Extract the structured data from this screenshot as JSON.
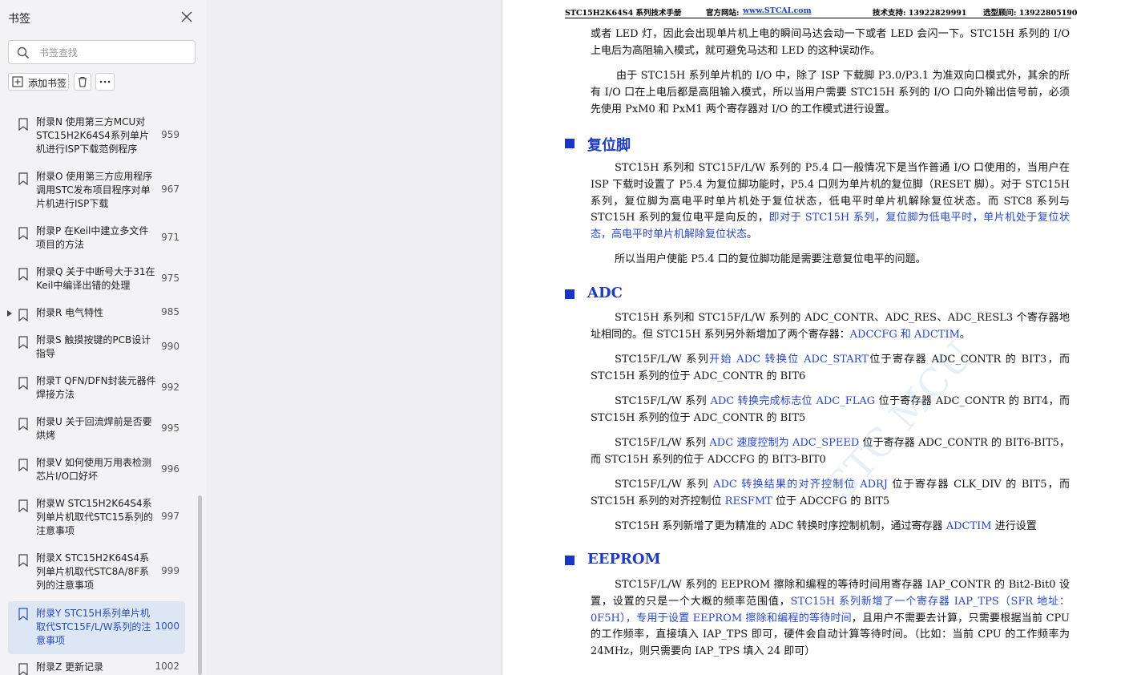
{
  "sidebar": {
    "title": "书签",
    "search_placeholder": "书签查找",
    "add_label": "添加书签",
    "items": [
      {
        "label": "附录N 使用第三方MCU对STC15H2K64S4系列单片机进行ISP下载范例程序",
        "page": "959"
      },
      {
        "label": "附录O 使用第三方应用程序调用STC发布项目程序对单片机进行ISP下载",
        "page": "967"
      },
      {
        "label": "附录P 在Keil中建立多文件项目的方法",
        "page": "971"
      },
      {
        "label": "附录Q 关于中断号大于31在Keil中编译出错的处理",
        "page": "975"
      },
      {
        "label": "附录R 电气特性",
        "page": "985"
      },
      {
        "label": "附录S 触摸按键的PCB设计指导",
        "page": "990"
      },
      {
        "label": "附录T QFN/DFN封装元器件焊接方法",
        "page": "992"
      },
      {
        "label": "附录U 关于回流焊前是否要烘烤",
        "page": "995"
      },
      {
        "label": "附录V 如何使用万用表检测芯片I/O口好坏",
        "page": "996"
      },
      {
        "label": "附录W STC15H2K64S4系列单片机取代STC15系列的注意事项",
        "page": "997"
      },
      {
        "label": "附录X STC15H2K64S4系列单片机取代STC8A/8F系列的注意事项",
        "page": "999"
      },
      {
        "label": "附录Y STC15H系列单片机取代STC15F/L/W系列的注意事项",
        "page": "1000"
      },
      {
        "label": "附录Z 更新记录",
        "page": "1002"
      }
    ]
  },
  "document": {
    "header": {
      "manual": "STC15H2K64S4 系列技术手册",
      "site_label": "官方网站:",
      "site_url": "www.STCAI.com",
      "support": "技术支持: 13922829991",
      "consult": "选型顾问: 13922805190"
    },
    "p1": "或者 LED 灯，因此会出现单片机上电的瞬间马达会动一下或者 LED 会闪一下。STC15H 系列的 I/O 上电后为高阻输入模式，就可避免马达和 LED 的这种误动作。",
    "p2": "由于 STC15H 系列单片机的 I/O 中，除了 ISP 下载脚 P3.0/P3.1 为准双向口模式外，其余的所有 I/O 口在上电后都是高阻输入模式，所以当用户需要 STC15H 系列的 I/O 口向外输出信号前，必须先使用 PxM0 和 PxM1 两个寄存器对 I/O 的工作模式进行设置。",
    "sec_reset": "复位脚",
    "reset_p1a": "STC15H 系列和 STC15F/L/W 系列的 P5.4 口一般情况下是当作普通 I/O 口使用的，当用户在 ISP 下载时设置了 P5.4 为复位脚功能时，P5.4 口则为单片机的复位脚（RESET 脚）。对于 STC15H 系列，复位脚为高电平时单片机处于复位状态，低电平时单片机解除复位状态。而 STC8 系列与 STC15H 系列的复位电平是向反的，",
    "reset_p1b": "即对于 STC15H 系列，复位脚为低电平时，单片机处于复位状态，高电平时单片机解除复位状态",
    "reset_p1c": "。",
    "reset_p2": "所以当用户使能 P5.4 口的复位脚功能是需要注意复位电平的问题。",
    "sec_adc": "ADC",
    "adc_p1a": "STC15H 系列和 STC15F/L/W 系列的 ADC_CONTR、ADC_RES、ADC_RESL3 个寄存器地址相同的。但 STC15H 系列另外新增加了两个寄存器：",
    "adc_p1b": "ADCCFG 和 ADCTIM",
    "adc_p1c": "。",
    "adc_p2a": "STC15F/L/W 系列",
    "adc_p2b": "开始 ADC 转换位 ADC_START",
    "adc_p2c": "位于寄存器 ADC_CONTR 的 BIT3，而 STC15H 系列的位于 ADC_CONTR 的 BIT6",
    "adc_p3a": "STC15F/L/W 系列 ",
    "adc_p3b": "ADC 转换完成标志位 ADC_FLAG",
    "adc_p3c": " 位于寄存器 ADC_CONTR 的 BIT4，而 STC15H 系列的位于 ADC_CONTR 的 BIT5",
    "adc_p4a": "STC15F/L/W 系列 ",
    "adc_p4b": "ADC 速度控制为 ADC_SPEED",
    "adc_p4c": " 位于寄存器 ADC_CONTR 的 BIT6-BIT5，而 STC15H 系列的位于 ADCCFG 的 BIT3-BIT0",
    "adc_p5a": "STC15F/L/W 系列 ",
    "adc_p5b": "ADC 转换结果的对齐控制位 ADRJ",
    "adc_p5c": " 位于寄存器 CLK_DIV 的 BIT5，而 STC15H 系列的对齐控制位 ",
    "adc_p5d": "RESFMT",
    "adc_p5e": " 位于 ADCCFG 的 BIT5",
    "adc_p6a": "STC15H 系列新增了更为精准的 ADC 转换时序控制机制，通过寄存器 ",
    "adc_p6b": "ADCTIM",
    "adc_p6c": " 进行设置",
    "sec_eeprom": "EEPROM",
    "ee_p1a": "STC15F/L/W 系列的 EEPROM 擦除和编程的等待时间用寄存器 IAP_CONTR 的 Bit2-Bit0 设置，设置的只是一个大概的频率范围值，",
    "ee_p1b": "STC15H 系列新增了一个寄存器 IAP_TPS（SFR 地址：0F5H），专用于设置 EEPROM 擦除和编程的等待时间",
    "ee_p1c": "，且用户不需要去计算，只需要根据当前 CPU 的工作频率，直接填入 IAP_TPS 即可，硬件会自动计算等待时间。（比如：当前 CPU 的工作频率为 24MHz，则只需要向 IAP_TPS 填入 24 即可）",
    "watermark": "STC MCU"
  }
}
